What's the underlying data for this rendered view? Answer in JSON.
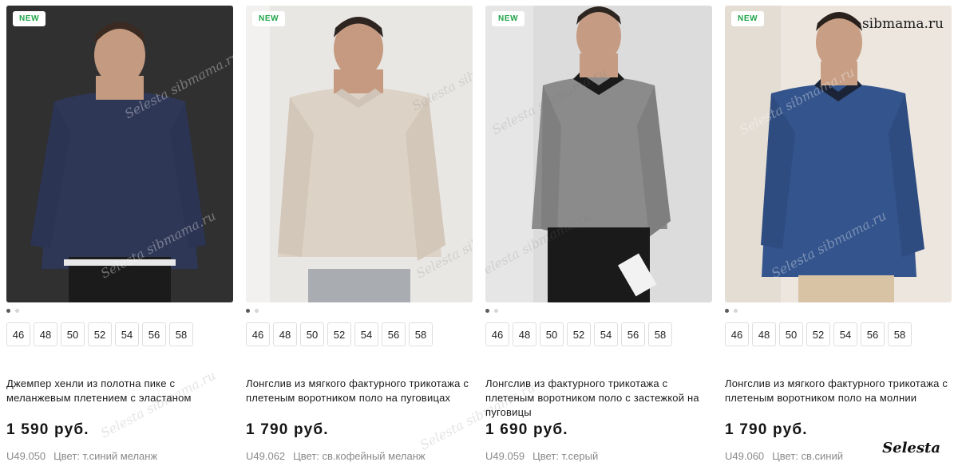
{
  "products": [
    {
      "badge": "NEW",
      "sizes": [
        "46",
        "48",
        "50",
        "52",
        "54",
        "56",
        "58"
      ],
      "title": "Джемпер хенли из полотна пике с меланжевым плетением с эластаном",
      "price": "1 590 руб.",
      "sku": "U49.050",
      "color_text": "Цвет: т.синий меланж",
      "swatch": "#2e3756",
      "bg": "#2a2a2a"
    },
    {
      "badge": "NEW",
      "sizes": [
        "46",
        "48",
        "50",
        "52",
        "54",
        "56",
        "58"
      ],
      "title": "Лонгслив из мягкого фактурного трикотажа с плетеным воротником поло на пуговицах",
      "price": "1 790 руб.",
      "sku": "U49.062",
      "color_text": "Цвет: св.кофейный меланж",
      "swatch": "#ddd2c6",
      "bg": "#e9e7e4"
    },
    {
      "badge": "NEW",
      "sizes": [
        "46",
        "48",
        "50",
        "52",
        "54",
        "56",
        "58"
      ],
      "title": "Лонгслив из фактурного трикотажа с плетеным воротником поло с застежкой на пуговицы",
      "price": "1 690 руб.",
      "sku": "U49.059",
      "color_text": "Цвет: т.серый",
      "swatch": "#8b8b8b",
      "bg": "#dcdcdc"
    },
    {
      "badge": "NEW",
      "sizes": [
        "46",
        "48",
        "50",
        "52",
        "54",
        "56",
        "58"
      ],
      "title": "Лонгслив из мягкого фактурного трикотажа с плетеным воротником поло на молнии",
      "price": "1 790 руб.",
      "sku": "U49.060",
      "color_text": "Цвет: св.синий",
      "swatch": "#33548c",
      "bg": "#ece6df"
    }
  ],
  "watermark": "Selesta sibmama.ru",
  "brand_top": "sibmama.ru",
  "brand_bottom": "Selesta",
  "colors": {
    "badge_text": "#1fa448",
    "size_border": "#dedede",
    "meta_gray": "#8a8a8a"
  }
}
